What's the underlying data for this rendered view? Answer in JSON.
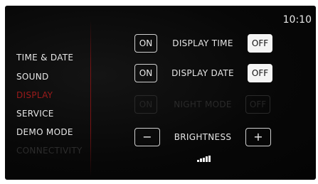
{
  "status_bar": {
    "time": "10:10"
  },
  "menu": {
    "items": [
      {
        "label": "TIME & DATE",
        "state": "normal"
      },
      {
        "label": "SOUND",
        "state": "normal"
      },
      {
        "label": "DISPLAY",
        "state": "active"
      },
      {
        "label": "SERVICE",
        "state": "normal"
      },
      {
        "label": "DEMO MODE",
        "state": "normal"
      },
      {
        "label": "CONNECTIVITY",
        "state": "disabled"
      }
    ]
  },
  "settings": {
    "display_time": {
      "label": "DISPLAY TIME",
      "on_label": "ON",
      "off_label": "OFF",
      "value": "OFF"
    },
    "display_date": {
      "label": "DISPLAY DATE",
      "on_label": "ON",
      "off_label": "OFF",
      "value": "OFF"
    },
    "night_mode": {
      "label": "NIGHT MODE",
      "on_label": "ON",
      "off_label": "OFF",
      "value": "OFF",
      "enabled": false
    },
    "brightness": {
      "label": "BRIGHTNESS",
      "decrease_label": "−",
      "increase_label": "+",
      "level": 5,
      "level_max": 5
    }
  },
  "colors": {
    "screen_background": "#060606",
    "active_accent": "#9c1b1b",
    "text": "#e6e6e6",
    "selected_fill": "#f4f4f4",
    "disabled_text": "#2a2a2a"
  },
  "icons": [
    "brightness-level-icon"
  ]
}
